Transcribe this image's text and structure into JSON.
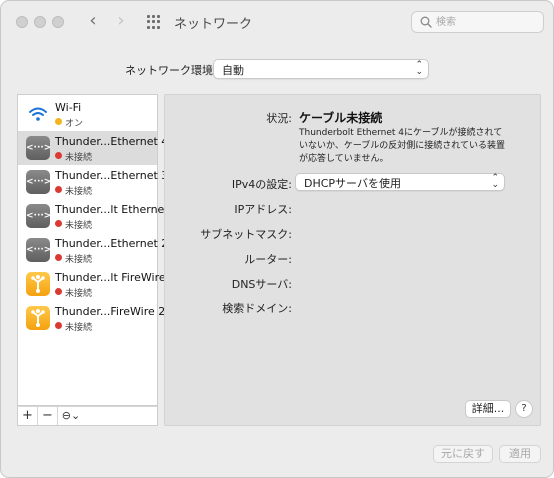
{
  "window": {
    "title": "ネットワーク"
  },
  "search": {
    "placeholder": "検索"
  },
  "location": {
    "label": "ネットワーク環境:",
    "value": "自動"
  },
  "services": [
    {
      "name": "Wi-Fi",
      "status": "オン",
      "status_color": "#f2b51b",
      "icon": "wifi-icon",
      "selected": false
    },
    {
      "name": "Thunder...Ethernet 4",
      "status": "未接続",
      "status_color": "#d93a33",
      "icon": "ethernet-icon",
      "selected": true
    },
    {
      "name": "Thunder...Ethernet 3",
      "status": "未接続",
      "status_color": "#d93a33",
      "icon": "ethernet-icon",
      "selected": false
    },
    {
      "name": "Thunder...lt Ethernet",
      "status": "未接続",
      "status_color": "#d93a33",
      "icon": "ethernet-icon",
      "selected": false
    },
    {
      "name": "Thunder...Ethernet 2",
      "status": "未接続",
      "status_color": "#d93a33",
      "icon": "ethernet-icon",
      "selected": false
    },
    {
      "name": "Thunder...lt FireWire",
      "status": "未接続",
      "status_color": "#d93a33",
      "icon": "firewire-icon",
      "selected": false
    },
    {
      "name": "Thunder...FireWire 2",
      "status": "未接続",
      "status_color": "#d93a33",
      "icon": "firewire-icon",
      "selected": false
    }
  ],
  "sidebar_buttons": {
    "add": "+",
    "remove": "−",
    "action": "⊖⌄"
  },
  "detail": {
    "status_label": "状況:",
    "status_value": "ケーブル未接続",
    "status_description": "Thunderbolt Ethernet 4にケーブルが接続されていないか、ケーブルの反対側に接続されている装置が応答していません。",
    "ipv4_label": "IPv4の設定:",
    "ipv4_value": "DHCPサーバを使用",
    "ip_label": "IPアドレス:",
    "subnet_label": "サブネットマスク:",
    "router_label": "ルーター:",
    "dns_label": "DNSサーバ:",
    "search_domain_label": "検索ドメイン:",
    "advanced_button": "詳細...",
    "help_button": "?"
  },
  "footer": {
    "revert": "元に戻す",
    "apply": "適用"
  },
  "colors": {
    "connected": "#f2b51b",
    "disconnected": "#d93a33",
    "selected_row": "#dcdcdc"
  }
}
